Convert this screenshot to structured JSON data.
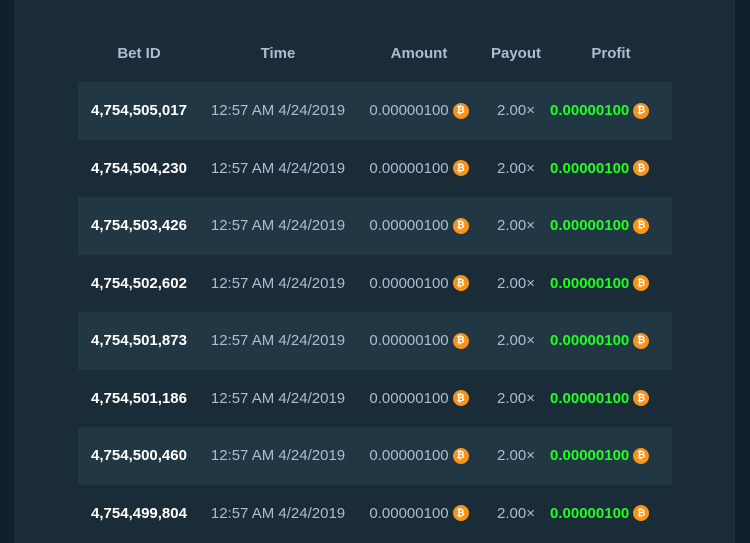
{
  "colors": {
    "background": "#0f212e",
    "panel": "#1a2c38",
    "row_alt": "#213743",
    "profit_green": "#1fff20",
    "btc_orange": "#f7931a",
    "muted_text": "#b1bad3"
  },
  "table": {
    "headers": {
      "bet_id": "Bet ID",
      "time": "Time",
      "amount": "Amount",
      "payout": "Payout",
      "profit": "Profit"
    },
    "coin_icon": "bitcoin-icon",
    "rows": [
      {
        "bet_id": "4,754,505,017",
        "time": "12:57 AM 4/24/2019",
        "amount": "0.00000100",
        "payout": "2.00×",
        "profit": "0.00000100"
      },
      {
        "bet_id": "4,754,504,230",
        "time": "12:57 AM 4/24/2019",
        "amount": "0.00000100",
        "payout": "2.00×",
        "profit": "0.00000100"
      },
      {
        "bet_id": "4,754,503,426",
        "time": "12:57 AM 4/24/2019",
        "amount": "0.00000100",
        "payout": "2.00×",
        "profit": "0.00000100"
      },
      {
        "bet_id": "4,754,502,602",
        "time": "12:57 AM 4/24/2019",
        "amount": "0.00000100",
        "payout": "2.00×",
        "profit": "0.00000100"
      },
      {
        "bet_id": "4,754,501,873",
        "time": "12:57 AM 4/24/2019",
        "amount": "0.00000100",
        "payout": "2.00×",
        "profit": "0.00000100"
      },
      {
        "bet_id": "4,754,501,186",
        "time": "12:57 AM 4/24/2019",
        "amount": "0.00000100",
        "payout": "2.00×",
        "profit": "0.00000100"
      },
      {
        "bet_id": "4,754,500,460",
        "time": "12:57 AM 4/24/2019",
        "amount": "0.00000100",
        "payout": "2.00×",
        "profit": "0.00000100"
      },
      {
        "bet_id": "4,754,499,804",
        "time": "12:57 AM 4/24/2019",
        "amount": "0.00000100",
        "payout": "2.00×",
        "profit": "0.00000100"
      }
    ]
  }
}
